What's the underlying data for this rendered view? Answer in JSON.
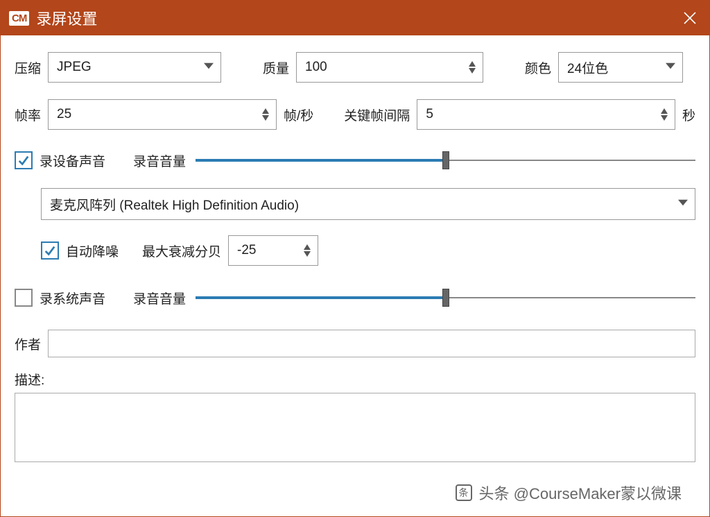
{
  "window": {
    "logo": "CM",
    "title": "录屏设置"
  },
  "row1": {
    "compress_label": "压缩",
    "compress_value": "JPEG",
    "quality_label": "质量",
    "quality_value": "100",
    "color_label": "颜色",
    "color_value": "24位色"
  },
  "row2": {
    "fps_label": "帧率",
    "fps_value": "25",
    "fps_unit": "帧/秒",
    "keyframe_label": "关键帧间隔",
    "keyframe_value": "5",
    "keyframe_unit": "秒"
  },
  "audio": {
    "record_device_label": "录设备声音",
    "record_device_checked": true,
    "volume_label": "录音音量",
    "device_slider_percent": 50,
    "device_value": "麦克风阵列 (Realtek High Definition Audio)",
    "auto_denoise_label": "自动降噪",
    "auto_denoise_checked": true,
    "max_attenuation_label": "最大衰减分贝",
    "max_attenuation_value": "-25",
    "record_system_label": "录系统声音",
    "record_system_checked": false,
    "system_slider_percent": 50
  },
  "meta": {
    "author_label": "作者",
    "author_value": "",
    "description_label": "描述:",
    "description_value": ""
  },
  "watermark": {
    "text": "头条 @CourseMaker蒙以微课",
    "overlay": "蒙以微课"
  }
}
